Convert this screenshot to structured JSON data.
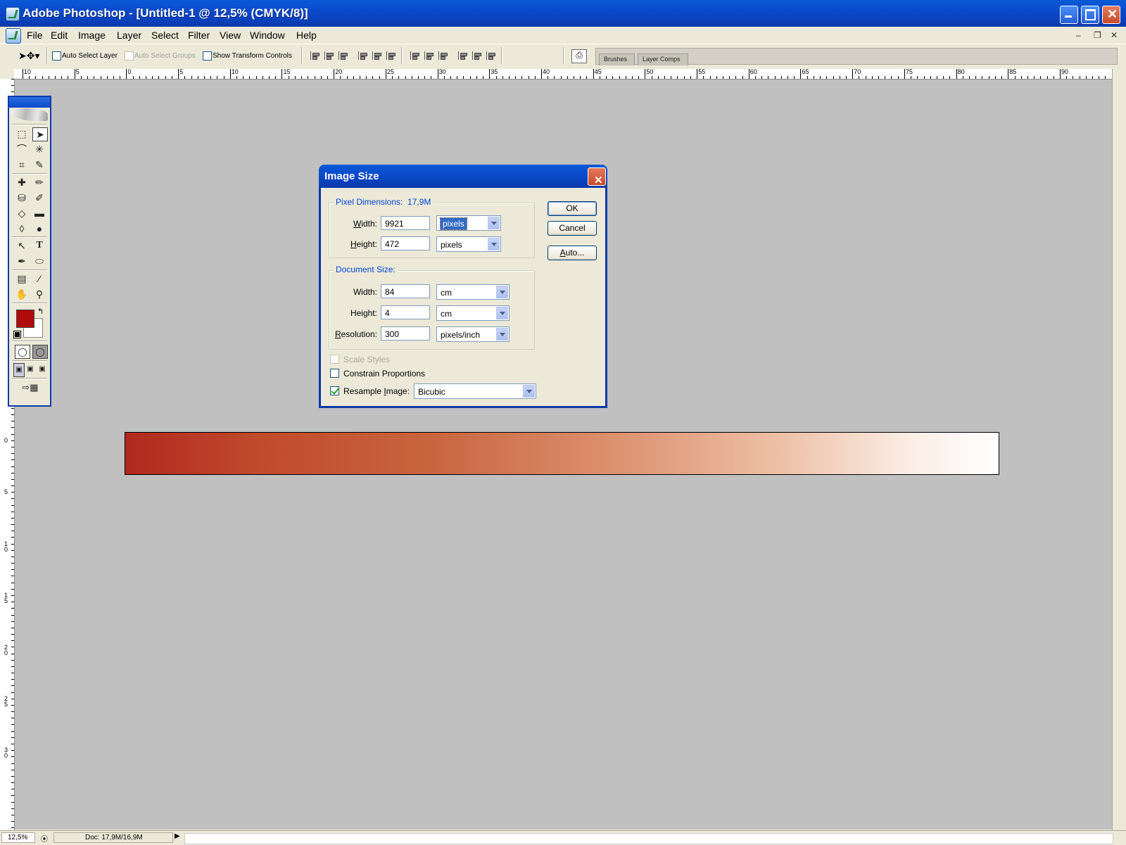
{
  "window": {
    "title": "Adobe Photoshop - [Untitled-1 @ 12,5% (CMYK/8)]"
  },
  "menu": [
    "File",
    "Edit",
    "Image",
    "Layer",
    "Select",
    "Filter",
    "View",
    "Window",
    "Help"
  ],
  "options": {
    "auto_select_layer": "Auto Select Layer",
    "auto_select_groups": "Auto Select Groups",
    "show_transform_controls": "Show Transform Controls"
  },
  "palette_tabs": [
    "Brushes",
    "Layer Comps"
  ],
  "ruler": {
    "top_labels": [
      "10",
      "5",
      "0",
      "5",
      "10",
      "15",
      "20",
      "25",
      "30",
      "35",
      "40",
      "45",
      "50",
      "55",
      "60",
      "65",
      "70",
      "75",
      "80",
      "85",
      "90"
    ],
    "left_labels": [
      "0",
      "5",
      "1 0",
      "1 5",
      "2 0",
      "2 5",
      "3 0"
    ]
  },
  "colors": {
    "foreground": "#b00a0a",
    "background": "#ffffff"
  },
  "dialog": {
    "title": "Image Size",
    "pixel_dimensions": {
      "label": "Pixel Dimensions:",
      "size": "17,9M",
      "width_label_u": "W",
      "width_label_rest": "idth:",
      "width_value": "9921",
      "width_unit": "pixels",
      "height_label_u": "H",
      "height_label_rest": "eight:",
      "height_value": "472",
      "height_unit": "pixels"
    },
    "document_size": {
      "label": "Document Size:",
      "width_label": "Width:",
      "width_value": "84",
      "width_unit": "cm",
      "height_label": "Height:",
      "height_value": "4",
      "height_unit": "cm",
      "resolution_label_u": "R",
      "resolution_label_rest": "esolution:",
      "resolution_value": "300",
      "resolution_unit": "pixels/inch"
    },
    "scale_styles": {
      "label": "Scale Styles",
      "checked": false,
      "disabled": true
    },
    "constrain": {
      "label": "Constrain Proportions",
      "checked": false
    },
    "resample": {
      "label_pre": "Resample ",
      "label_u": "I",
      "label_rest": "mage:",
      "checked": true,
      "method": "Bicubic"
    },
    "buttons": {
      "ok": "OK",
      "cancel": "Cancel",
      "auto_u": "A",
      "auto_rest": "uto..."
    }
  },
  "status": {
    "zoom": "12,5%",
    "doc": "Doc: 17,9M/16,9M"
  }
}
